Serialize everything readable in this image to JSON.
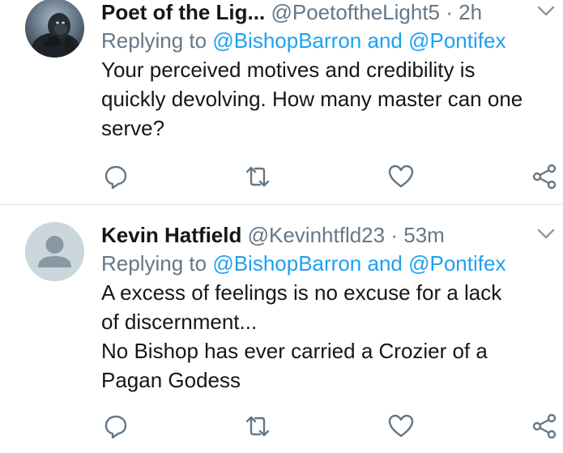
{
  "tweets": [
    {
      "name": "Poet of the Lig...",
      "handle": "@PoetoftheLight5",
      "time": "2h",
      "replying_prefix": "Replying to",
      "reply_to_1": "@BishopBarron",
      "reply_and": "and",
      "reply_to_2": "@Pontifex",
      "text_lines": [
        "Your perceived motives and credibility is",
        "quickly devolving. How many master can one",
        "serve?"
      ]
    },
    {
      "name": "Kevin Hatfield",
      "handle": "@Kevinhtfld23",
      "time": "53m",
      "replying_prefix": "Replying to",
      "reply_to_1": "@BishopBarron",
      "reply_and": "and",
      "reply_to_2": "@Pontifex",
      "text_lines": [
        "A excess of feelings is no excuse for a lack",
        "of discernment...",
        "No Bishop has ever carried a Crozier of a",
        "Pagan Godess"
      ]
    }
  ],
  "separator": "·",
  "icons": {
    "reply": "reply-icon",
    "retweet": "retweet-icon",
    "like": "heart-icon",
    "share": "share-icon",
    "menu": "chevron-down-icon"
  },
  "colors": {
    "link": "#1da1f2",
    "muted": "#657786",
    "text": "#14171a",
    "divider": "#e1e8ed"
  }
}
